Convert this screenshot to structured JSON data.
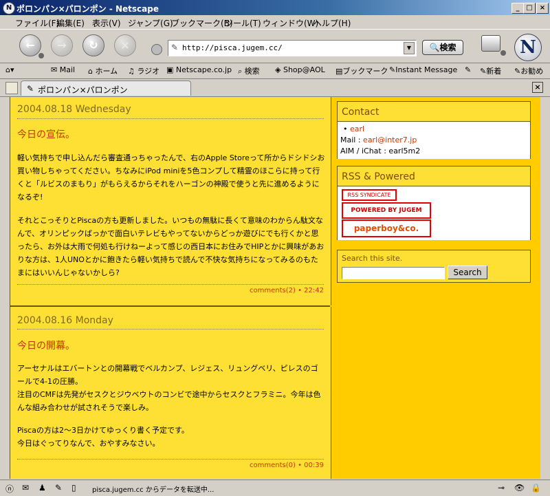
{
  "window": {
    "title": "ポロンパン×パロンポン - Netscape",
    "minimize": "_",
    "maximize": "□",
    "close": "×"
  },
  "menu": [
    "ファイル(F)",
    "編集(E)",
    "表示(V)",
    "ジャンプ(G)",
    "ブックマーク(B)",
    "ツール(T)",
    "ウィンドウ(W)",
    "ヘルプ(H)"
  ],
  "nav": {
    "url": "http://pisca.jugem.cc/",
    "search_label": "検索"
  },
  "personal_toolbar": [
    "Mail",
    "ホーム",
    "ラジオ",
    "Netscape.co.jp",
    "検索",
    "Shop@AOL",
    "ブックマーク",
    "Instant Message",
    "新着",
    "お勧め"
  ],
  "tab": {
    "label": "ポロンパン×パロンポン"
  },
  "posts": [
    {
      "date": "2004.08.18 Wednesday",
      "title": "今日の宣伝。",
      "paragraphs": [
        "軽い気持ちで申し込んだら審査通っちゃったんで、右のApple Storeって所からドシドシお買い物しちゃってください。ちなみにiPod miniを5色コンプして精霊のほこらに持って行くと「ルビスのまもり」がもらえるからそれをハーゴンの神殿で使うと先に進めるようになるぞ!",
        "それとこっそりとPiscaの方も更新しました。いつもの無駄に長くて意味のわからん駄文なんで、オリンピックばっかで面白いテレビもやってないからどっか遊びにでも行くかと思ったら、お外は大雨で何処も行けねーよって感じの西日本にお住みでHIPとかに興味があおりな方は、1人UNOとかに飽きたら軽い気持ちで読んで不快な気持ちになってみるのもたまにはいいんじゃないかしら?"
      ],
      "comments": "comments(2)",
      "time": "22:42"
    },
    {
      "date": "2004.08.16 Monday",
      "title": "今日の開幕。",
      "paragraphs": [
        "アーセナルはエバートンとの開幕戦でベルカンプ、レジェス、リュングベリ、ピレスのゴールで4-1の圧勝。\n注目のCMFは先発がセスクとジウベウトのコンビで途中からセスクとフラミニ。今年は色んな組み合わせが試されそうで楽しみ。",
        "Piscaの方は2～3日かけてゆっくり書く予定です。\n今日はぐってりなんで、おやすみなさい。"
      ],
      "comments": "comments(0)",
      "time": "00:39"
    }
  ],
  "sidebar": {
    "contact": {
      "heading": "Contact",
      "link": "earl",
      "mail_label": "Mail : ",
      "mail": "earl@inter7.jp",
      "aim": "AIM / iChat : earl5m2"
    },
    "rss": {
      "heading": "RSS & Powered",
      "badges": [
        "RSS  SYNDICATE",
        "POWERED BY  JUGEM",
        "paperboy&co."
      ]
    },
    "search": {
      "heading": "Search this site.",
      "button": "Search"
    }
  },
  "status": {
    "text": "pisca.jugem.cc からデータを転送中..."
  },
  "colors": {
    "page_bg": "#ffcc00",
    "post_bg": "#fee034",
    "accent": "#c43500"
  }
}
